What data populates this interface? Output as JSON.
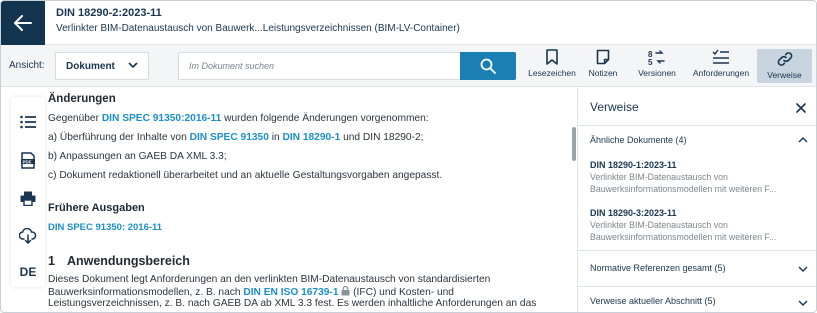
{
  "header": {
    "doc_id": "DIN 18290-2:2023-11",
    "doc_title": "Verlinkter BIM-Datenaustausch von Bauwerk...Leistungsverzeichnissen (BIM-LV-Container)"
  },
  "toolbar": {
    "view_label": "Ansicht:",
    "view_value": "Dokument",
    "search_placeholder": "Im Dokument suchen",
    "tools": [
      {
        "label": "Lesezeichen",
        "icon": "bookmark-icon"
      },
      {
        "label": "Notizen",
        "icon": "note-icon"
      },
      {
        "label": "Versionen",
        "icon": "versions-icon"
      },
      {
        "label": "Anforderungen",
        "icon": "requirements-list-icon"
      },
      {
        "label": "Verweise",
        "icon": "link-icon"
      }
    ]
  },
  "rail": {
    "items": [
      "toc-list-icon",
      "pdf-icon",
      "print-icon",
      "download-cloud-icon"
    ],
    "language": "DE"
  },
  "content": {
    "changes_heading": "Änderungen",
    "changes_intro_pre": "Gegenüber ",
    "changes_intro_link": "DIN SPEC 91350:2016-11",
    "changes_intro_post": " wurden folgende Änderungen vorgenommen:",
    "item_a_pre": "a)  Überführung der Inhalte von ",
    "item_a_link1": "DIN SPEC 91350",
    "item_a_mid": " in ",
    "item_a_link2": "DIN 18290-1",
    "item_a_post": " und DIN 18290-2;",
    "item_b": "b)  Anpassungen an GAEB DA XML 3.3;",
    "item_c": "c)  Dokument redaktionell überarbeitet und an aktuelle Gestaltungsvorgaben angepasst.",
    "earlier_heading": "Frühere Ausgaben",
    "earlier_link": "DIN SPEC 91350: 2016-11",
    "scope_number": "1",
    "scope_heading": "Anwendungsbereich",
    "scope_line1": "Dieses Dokument legt Anforderungen an den verlinkten BIM-Datenaustausch von standardisierten",
    "scope_line2_pre": "Bauwerksinformationsmodellen, z. B. nach ",
    "scope_line2_link": "DIN EN ISO 16739-1",
    "scope_line2_post": " (IFC) und Kosten- und",
    "scope_line3": "Leistungsverzeichnissen, z. B. nach GAEB DA ab XML 3.3 fest. Es werden inhaltliche Anforderungen an das"
  },
  "panel": {
    "title": "Verweise",
    "similar_heading": "Ähnliche Dokumente (4)",
    "docs": [
      {
        "id": "DIN 18290-1:2023-11",
        "desc1": "Verlinkter BIM-Datenaustausch von",
        "desc2": "Bauwerksinformationsmodellen mit weiteren F..."
      },
      {
        "id": "DIN 18290-3:2023-11",
        "desc1": "Verlinkter BIM-Datenaustausch von",
        "desc2": "Bauwerksinformationsmodellen mit weiteren F..."
      }
    ],
    "normative_heading": "Normative Referenzen gesamt (5)",
    "current_section_heading": "Verweise aktueller Abschnitt (5)"
  },
  "colors": {
    "dark_navy": "#12344f",
    "link_blue": "#1b8fc9",
    "search_blue": "#1b7fb4",
    "active_tool": "#c8d4e0"
  }
}
